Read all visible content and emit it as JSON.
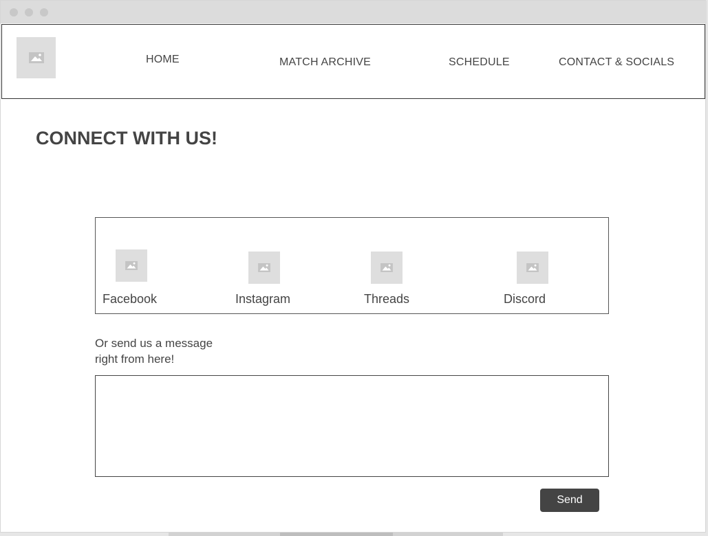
{
  "nav": {
    "items": [
      {
        "label": "HOME"
      },
      {
        "label": "MATCH ARCHIVE"
      },
      {
        "label": "SCHEDULE"
      },
      {
        "label": "CONTACT & SOCIALS"
      }
    ]
  },
  "page": {
    "title": "CONNECT WITH US!"
  },
  "socials": [
    {
      "label": "Facebook"
    },
    {
      "label": "Instagram"
    },
    {
      "label": "Threads"
    },
    {
      "label": "Discord"
    }
  ],
  "message": {
    "prompt_line1": "Or send us a message",
    "prompt_line2": "right from here!",
    "value": "",
    "send_label": "Send"
  },
  "colors": {
    "text": "#444444",
    "placeholder_bg": "#dedede",
    "button_bg": "#444444",
    "button_text": "#ffffff"
  }
}
